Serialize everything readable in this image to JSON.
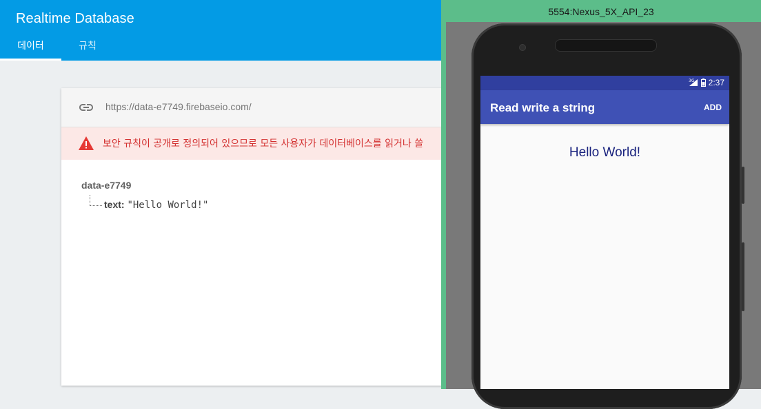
{
  "console": {
    "title": "Realtime Database",
    "tabs": [
      "데이터",
      "규칙"
    ],
    "db_url": "https://data-e7749.firebaseio.com/",
    "warning": "보안 규칙이 공개로 정의되어 있으므로 모든 사용자가 데이터베이스를 읽거나 쓸",
    "tree": {
      "root": "data-e7749",
      "child_key": "text:",
      "child_value": "\"Hello World!\""
    }
  },
  "emulator": {
    "window_title": "5554:Nexus_5X_API_23",
    "status": {
      "network": "3G",
      "time": "2:37"
    },
    "app": {
      "title": "Read write a string",
      "action": "ADD",
      "content": "Hello World!"
    }
  },
  "colors": {
    "console_header": "#039be5",
    "warning_bg": "#fce8e6",
    "warning_text": "#d32f2f",
    "emulator_frame": "#5cbd8a",
    "status_bar": "#303f9f",
    "toolbar": "#3f51b5",
    "hello_text": "#1a237e"
  }
}
